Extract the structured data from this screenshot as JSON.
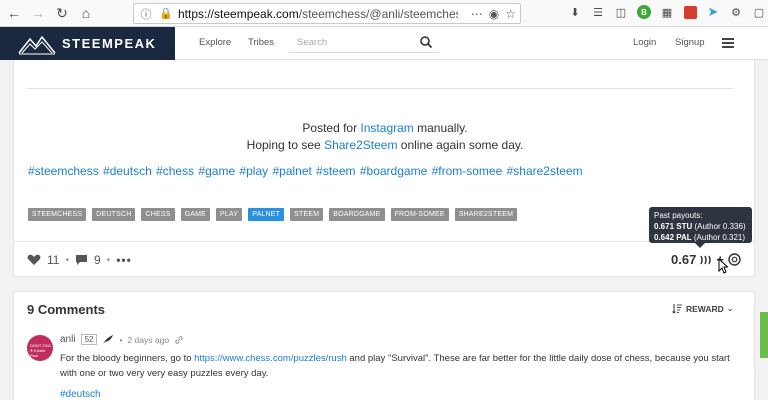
{
  "browser": {
    "url_host": "https://steempeak.com",
    "url_path": "/steemchess/@anli/steemchess-pu"
  },
  "header": {
    "logo_text": "STEEMPEAK",
    "nav": [
      "Explore",
      "Tribes"
    ],
    "search_placeholder": "Search",
    "login": "Login",
    "signup": "Signup"
  },
  "post": {
    "posted_prefix": "Posted for ",
    "posted_link": "Instagram",
    "posted_suffix": " manually.",
    "hoping_prefix": "Hoping to see ",
    "hoping_link": "Share2Steem",
    "hoping_suffix": " online again some day.",
    "hashtags": "#steemchess #deutsch #chess #game #play #palnet #steem #boardgame #from-somee #share2steem",
    "tags": [
      "STEEMCHESS",
      "DEUTSCH",
      "CHESS",
      "GAME",
      "PLAY",
      "PALNET",
      "STEEM",
      "BOARDGAME",
      "FROM-SOMEE",
      "SHARE2STEEM"
    ],
    "active_tag": "PALNET",
    "votes": "11",
    "comments": "9",
    "payout": "0.67",
    "payout_plus": "+"
  },
  "tooltip": {
    "title": "Past payouts:",
    "line1_value": "0.671 STU",
    "line1_detail": " (Author 0.336)",
    "line2_value": "0.642 PAL",
    "line2_detail": " (Author 0.321)"
  },
  "comments": {
    "title": "9 Comments",
    "sort_label": "REWARD",
    "first": {
      "author": "anli",
      "reputation": "52",
      "time": "2 days ago",
      "avatar_text": "DONT 2011 ® Kinder Paul",
      "body_prefix": "For the bloody beginners, go to ",
      "body_link": "https://www.chess.com/puzzles/rush",
      "body_suffix": " and play \"Survival\". These are far better for the little daily dose of chess, because you start with one or two very very easy puzzles every day.",
      "tag": "#deutsch"
    }
  },
  "colors": {
    "brand_dark": "#1b2940",
    "link": "#1a7fd4",
    "tag_grey": "#8f8f8f",
    "tag_active": "#2b90e0",
    "tooltip_bg": "#2f3540"
  }
}
